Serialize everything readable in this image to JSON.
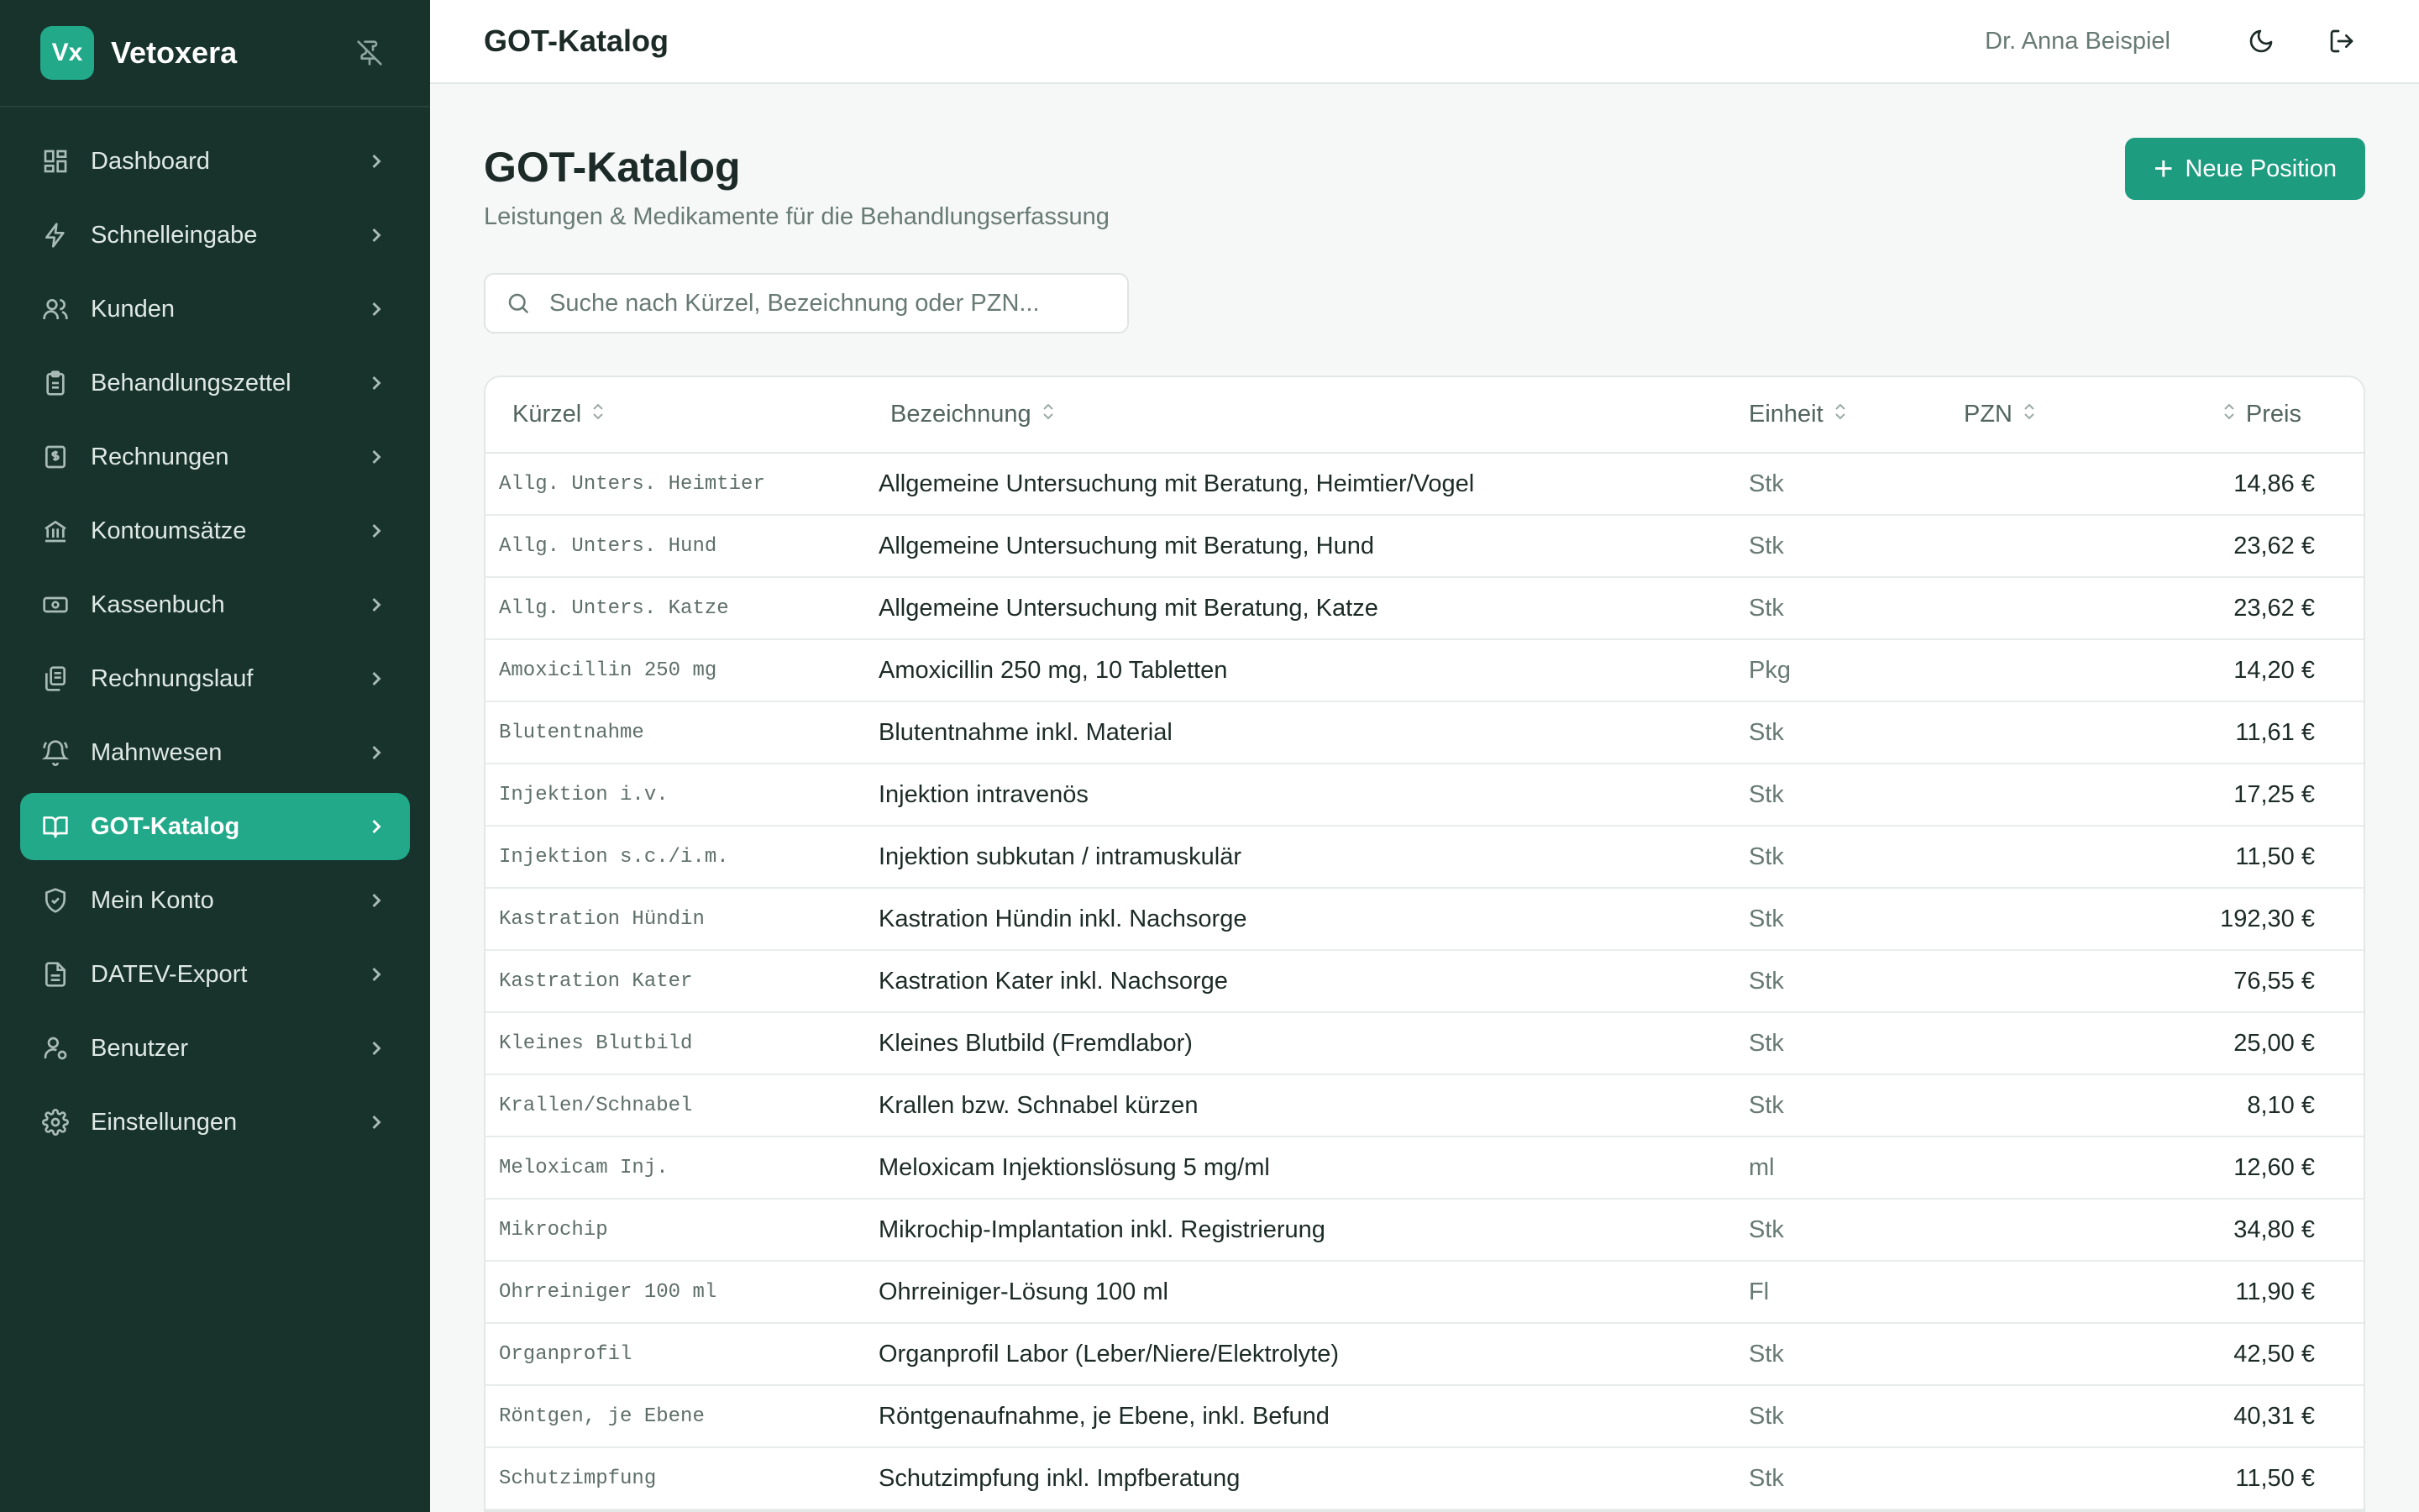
{
  "brand": {
    "logo": "Vx",
    "name": "Vetoxera"
  },
  "sidebar": {
    "items": [
      {
        "label": "Dashboard",
        "icon": "dashboard-icon"
      },
      {
        "label": "Schnelleingabe",
        "icon": "lightning-icon"
      },
      {
        "label": "Kunden",
        "icon": "users-icon"
      },
      {
        "label": "Behandlungszettel",
        "icon": "clipboard-icon"
      },
      {
        "label": "Rechnungen",
        "icon": "invoice-icon"
      },
      {
        "label": "Kontoumsätze",
        "icon": "bank-icon"
      },
      {
        "label": "Kassenbuch",
        "icon": "cash-icon"
      },
      {
        "label": "Rechnungslauf",
        "icon": "documents-icon"
      },
      {
        "label": "Mahnwesen",
        "icon": "bell-icon"
      },
      {
        "label": "GOT-Katalog",
        "icon": "book-icon",
        "active": true
      },
      {
        "label": "Mein Konto",
        "icon": "shield-icon"
      },
      {
        "label": "DATEV-Export",
        "icon": "file-export-icon"
      },
      {
        "label": "Benutzer",
        "icon": "user-settings-icon"
      },
      {
        "label": "Einstellungen",
        "icon": "gear-icon"
      }
    ]
  },
  "topbar": {
    "title": "GOT-Katalog",
    "user": "Dr. Anna Beispiel"
  },
  "page": {
    "title": "GOT-Katalog",
    "subtitle": "Leistungen & Medikamente für die Behandlungserfassung",
    "new_button": "Neue Position",
    "search_placeholder": "Suche nach Kürzel, Bezeichnung oder PZN..."
  },
  "table": {
    "columns": {
      "code": "Kürzel",
      "desc": "Bezeichnung",
      "unit": "Einheit",
      "pzn": "PZN",
      "price": "Preis"
    },
    "rows": [
      {
        "code": "Allg. Unters. Heimtier",
        "desc": "Allgemeine Untersuchung mit Beratung, Heimtier/Vogel",
        "unit": "Stk",
        "pzn": "",
        "price": "14,86 €"
      },
      {
        "code": "Allg. Unters. Hund",
        "desc": "Allgemeine Untersuchung mit Beratung, Hund",
        "unit": "Stk",
        "pzn": "",
        "price": "23,62 €"
      },
      {
        "code": "Allg. Unters. Katze",
        "desc": "Allgemeine Untersuchung mit Beratung, Katze",
        "unit": "Stk",
        "pzn": "",
        "price": "23,62 €"
      },
      {
        "code": "Amoxicillin 250 mg",
        "desc": "Amoxicillin 250 mg, 10 Tabletten",
        "unit": "Pkg",
        "pzn": "",
        "price": "14,20 €"
      },
      {
        "code": "Blutentnahme",
        "desc": "Blutentnahme inkl. Material",
        "unit": "Stk",
        "pzn": "",
        "price": "11,61 €"
      },
      {
        "code": "Injektion i.v.",
        "desc": "Injektion intravenös",
        "unit": "Stk",
        "pzn": "",
        "price": "17,25 €"
      },
      {
        "code": "Injektion s.c./i.m.",
        "desc": "Injektion subkutan / intramuskulär",
        "unit": "Stk",
        "pzn": "",
        "price": "11,50 €"
      },
      {
        "code": "Kastration Hündin",
        "desc": "Kastration Hündin inkl. Nachsorge",
        "unit": "Stk",
        "pzn": "",
        "price": "192,30 €"
      },
      {
        "code": "Kastration Kater",
        "desc": "Kastration Kater inkl. Nachsorge",
        "unit": "Stk",
        "pzn": "",
        "price": "76,55 €"
      },
      {
        "code": "Kleines Blutbild",
        "desc": "Kleines Blutbild (Fremdlabor)",
        "unit": "Stk",
        "pzn": "",
        "price": "25,00 €"
      },
      {
        "code": "Krallen/Schnabel",
        "desc": "Krallen bzw. Schnabel kürzen",
        "unit": "Stk",
        "pzn": "",
        "price": "8,10 €"
      },
      {
        "code": "Meloxicam Inj.",
        "desc": "Meloxicam Injektionslösung 5 mg/ml",
        "unit": "ml",
        "pzn": "",
        "price": "12,60 €"
      },
      {
        "code": "Mikrochip",
        "desc": "Mikrochip-Implantation inkl. Registrierung",
        "unit": "Stk",
        "pzn": "",
        "price": "34,80 €"
      },
      {
        "code": "Ohrreiniger 100 ml",
        "desc": "Ohrreiniger-Lösung 100 ml",
        "unit": "Fl",
        "pzn": "",
        "price": "11,90 €"
      },
      {
        "code": "Organprofil",
        "desc": "Organprofil Labor (Leber/Niere/Elektrolyte)",
        "unit": "Stk",
        "pzn": "",
        "price": "42,50 €"
      },
      {
        "code": "Röntgen, je Ebene",
        "desc": "Röntgenaufnahme, je Ebene, inkl. Befund",
        "unit": "Stk",
        "pzn": "",
        "price": "40,31 €"
      },
      {
        "code": "Schutzimpfung",
        "desc": "Schutzimpfung inkl. Impfberatung",
        "unit": "Stk",
        "pzn": "",
        "price": "11,50 €"
      }
    ]
  },
  "colors": {
    "sidebar_bg": "#17332c",
    "accent": "#21a98a",
    "primary_button": "#1e9c80"
  }
}
